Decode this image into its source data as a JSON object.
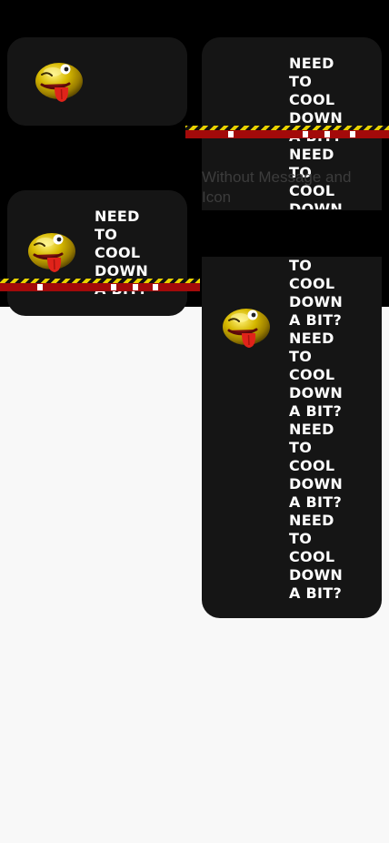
{
  "cards": {
    "empty_icon_only": {
      "icon": "tongue-out-emoji-icon"
    },
    "short_message": {
      "icon": "tongue-out-emoji-icon",
      "lines": [
        "NEED",
        "TO",
        "COOL",
        "DOWN",
        "A BIT?"
      ]
    },
    "top_right": {
      "lines": [
        "NEED",
        "TO",
        "COOL",
        "DOWN",
        "A BIT?",
        "NEED",
        "TO",
        "COOL",
        "DOWN"
      ]
    },
    "long_message": {
      "icon": "tongue-out-emoji-icon",
      "lines": [
        "TO",
        "COOL",
        "DOWN",
        "A BIT?",
        "NEED",
        "TO",
        "COOL",
        "DOWN",
        "A BIT?",
        "NEED",
        "TO",
        "COOL",
        "DOWN",
        "A BIT?",
        "NEED",
        "TO",
        "COOL",
        "DOWN",
        "A BIT?"
      ]
    }
  },
  "caption": "Without Message and Icon",
  "colors": {
    "background": "#f8f8f8",
    "top_band": "#000000",
    "card": "#151515",
    "tape_red": "#a30a0a",
    "tape_yellow": "#e8d100"
  }
}
